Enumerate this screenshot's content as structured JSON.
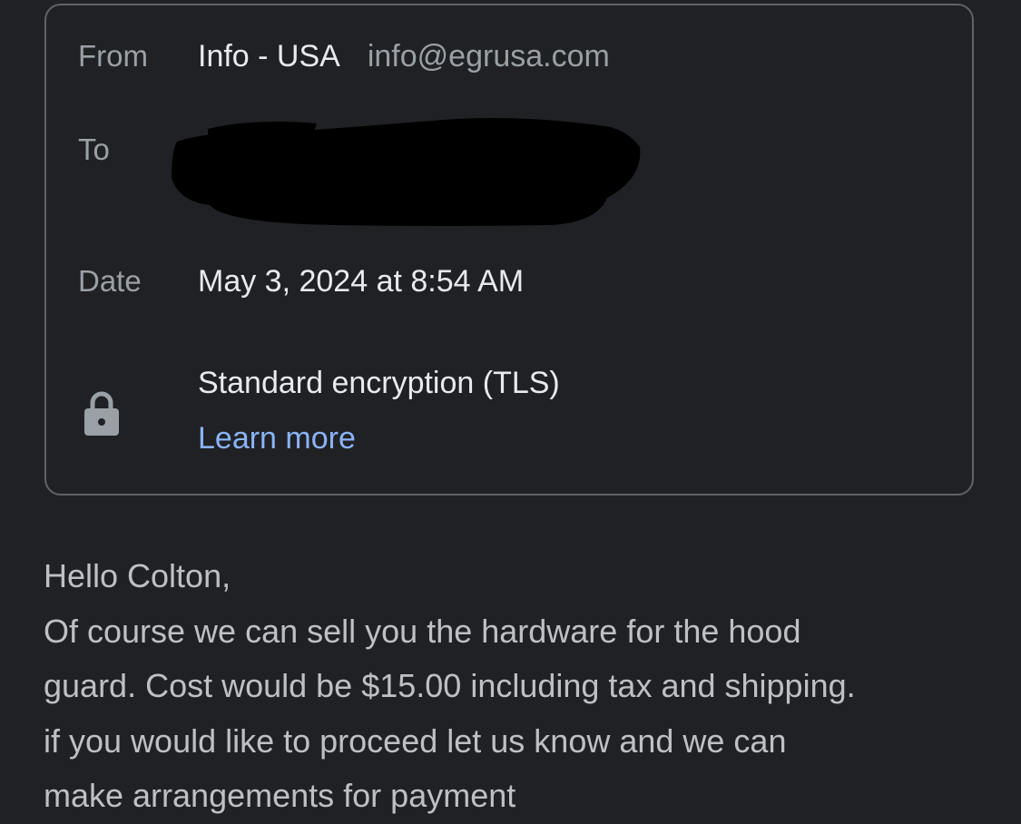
{
  "message_details": {
    "from": {
      "label": "From",
      "sender_name": "Info - USA",
      "sender_email": "info@egrusa.com"
    },
    "to": {
      "label": "To"
    },
    "date": {
      "label": "Date",
      "value": "May 3, 2024 at 8:54 AM"
    },
    "security": {
      "icon": "lock-icon",
      "encryption": "Standard encryption (TLS)",
      "learn_more": "Learn more"
    }
  },
  "message_body": {
    "lines": [
      "Hello Colton,",
      "Of course we can sell you the hardware for the hood",
      "guard. Cost would be $15.00 including tax and shipping.",
      "if you would like to proceed let us know and we can",
      "make arrangements for payment"
    ]
  },
  "colors": {
    "background": "#202124",
    "card_border": "#5f6368",
    "link": "#8ab4f8"
  }
}
